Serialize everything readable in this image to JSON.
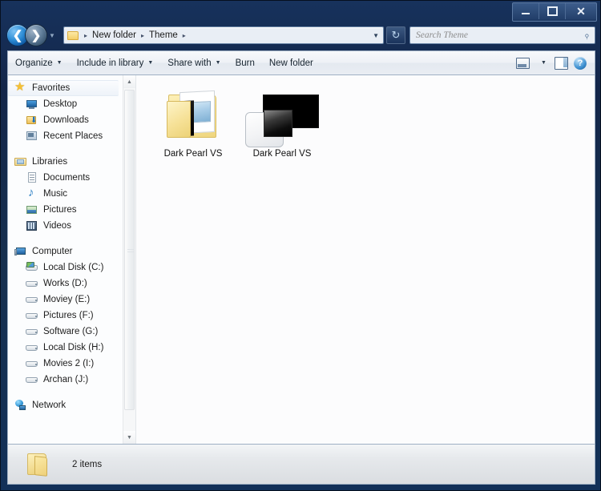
{
  "window": {
    "controls": {
      "minimize": "minimize",
      "maximize": "maximize",
      "close": "close"
    }
  },
  "addressbar": {
    "back_label": "◄",
    "forward_label": "►",
    "history_caret": "▼",
    "crumbs": [
      "New folder",
      "Theme"
    ],
    "separator": "▸",
    "dropdown_caret": "▼",
    "refresh_label": "↻"
  },
  "search": {
    "placeholder": "Search Theme",
    "icon": "search-icon",
    "glyph": "⌕"
  },
  "toolbar": {
    "items": [
      {
        "label": "Organize",
        "caret": "▼"
      },
      {
        "label": "Include in library",
        "caret": "▼"
      },
      {
        "label": "Share with",
        "caret": "▼"
      },
      {
        "label": "Burn",
        "caret": ""
      },
      {
        "label": "New folder",
        "caret": ""
      }
    ],
    "view_caret": "▼",
    "help_label": "?"
  },
  "sidebar": {
    "sections": [
      {
        "header": {
          "label": "Favorites",
          "icon": "star-icon",
          "selected": true
        },
        "items": [
          {
            "label": "Desktop",
            "icon": "desktop-icon"
          },
          {
            "label": "Downloads",
            "icon": "downloads-icon"
          },
          {
            "label": "Recent Places",
            "icon": "recent-places-icon"
          }
        ]
      },
      {
        "header": {
          "label": "Libraries",
          "icon": "libraries-icon",
          "selected": false
        },
        "items": [
          {
            "label": "Documents",
            "icon": "documents-icon"
          },
          {
            "label": "Music",
            "icon": "music-icon"
          },
          {
            "label": "Pictures",
            "icon": "pictures-icon"
          },
          {
            "label": "Videos",
            "icon": "videos-icon"
          }
        ]
      },
      {
        "header": {
          "label": "Computer",
          "icon": "computer-icon",
          "selected": false
        },
        "items": [
          {
            "label": "Local Disk (C:)",
            "icon": "system-drive-icon"
          },
          {
            "label": "Works (D:)",
            "icon": "drive-icon"
          },
          {
            "label": "Moviey (E:)",
            "icon": "drive-icon"
          },
          {
            "label": "Pictures (F:)",
            "icon": "drive-icon"
          },
          {
            "label": "Software (G:)",
            "icon": "drive-icon"
          },
          {
            "label": "Local Disk (H:)",
            "icon": "drive-icon"
          },
          {
            "label": "Movies  2 (I:)",
            "icon": "drive-icon"
          },
          {
            "label": "Archan (J:)",
            "icon": "drive-icon"
          }
        ]
      },
      {
        "header": {
          "label": "Network",
          "icon": "network-icon",
          "selected": false
        },
        "items": []
      }
    ],
    "scrollbar": {
      "up": "▲",
      "down": "▼"
    }
  },
  "content": {
    "items": [
      {
        "label": "Dark Pearl VS",
        "type": "folder"
      },
      {
        "label": "Dark Pearl VS",
        "type": "theme"
      }
    ]
  },
  "status": {
    "text": "2 items",
    "icon": "folder-icon"
  },
  "colors": {
    "titlebar": "#16304f",
    "content_bg": "#fcfcfd",
    "accent": "#2f8ed6",
    "toolbar_bg": "#eef1f6"
  }
}
